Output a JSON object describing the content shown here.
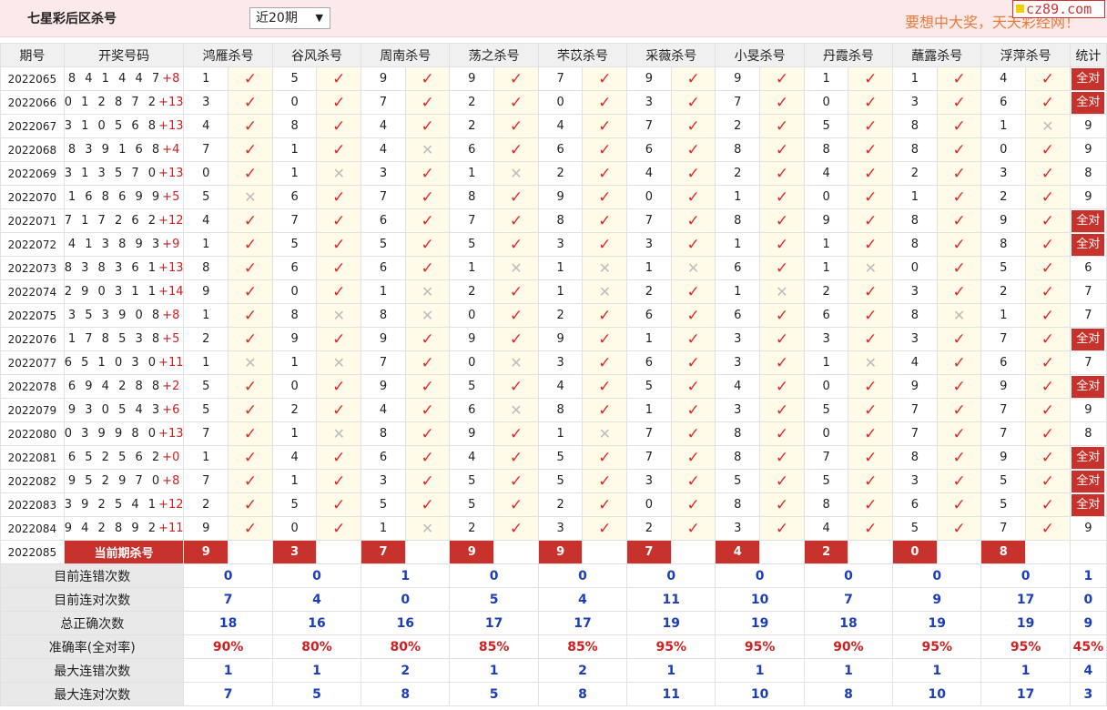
{
  "header": {
    "title": "七星彩后区杀号",
    "range_select": "近20期",
    "slogan": "要想中大奖，天天彩经网！",
    "logo_text": "cz89.com"
  },
  "columns": {
    "period": "期号",
    "draw": "开奖号码",
    "experts": [
      "鸿雁杀号",
      "谷风杀号",
      "周南杀号",
      "荡之杀号",
      "芣苡杀号",
      "采薇杀号",
      "小旻杀号",
      "丹霞杀号",
      "蘸露杀号",
      "浮萍杀号"
    ],
    "stat": "统计"
  },
  "rows": [
    {
      "period": "2022065",
      "nums": "8 4 1 4 4 7",
      "bonus": "+8",
      "picks": [
        "1",
        "5",
        "9",
        "9",
        "7",
        "9",
        "9",
        "1",
        "1",
        "4"
      ],
      "marks": [
        1,
        1,
        1,
        1,
        1,
        1,
        1,
        1,
        1,
        1
      ],
      "stat": "全对"
    },
    {
      "period": "2022066",
      "nums": "0 1 2 8 7 2",
      "bonus": "+13",
      "picks": [
        "3",
        "0",
        "7",
        "2",
        "0",
        "3",
        "7",
        "0",
        "3",
        "6"
      ],
      "marks": [
        1,
        1,
        1,
        1,
        1,
        1,
        1,
        1,
        1,
        1
      ],
      "stat": "全对"
    },
    {
      "period": "2022067",
      "nums": "3 1 0 5 6 8",
      "bonus": "+13",
      "picks": [
        "4",
        "8",
        "4",
        "2",
        "4",
        "7",
        "2",
        "5",
        "8",
        "1"
      ],
      "marks": [
        1,
        1,
        1,
        1,
        1,
        1,
        1,
        1,
        1,
        0
      ],
      "stat": "9"
    },
    {
      "period": "2022068",
      "nums": "8 3 9 1 6 8",
      "bonus": "+4",
      "picks": [
        "7",
        "1",
        "4",
        "6",
        "6",
        "6",
        "8",
        "8",
        "8",
        "0"
      ],
      "marks": [
        1,
        1,
        0,
        1,
        1,
        1,
        1,
        1,
        1,
        1
      ],
      "stat": "9"
    },
    {
      "period": "2022069",
      "nums": "3 1 3 5 7 0",
      "bonus": "+13",
      "picks": [
        "0",
        "1",
        "3",
        "1",
        "2",
        "4",
        "2",
        "4",
        "2",
        "3"
      ],
      "marks": [
        1,
        0,
        1,
        0,
        1,
        1,
        1,
        1,
        1,
        1
      ],
      "stat": "8"
    },
    {
      "period": "2022070",
      "nums": "1 6 8 6 9 9",
      "bonus": "+5",
      "picks": [
        "5",
        "6",
        "7",
        "8",
        "9",
        "0",
        "1",
        "0",
        "1",
        "2"
      ],
      "marks": [
        0,
        1,
        1,
        1,
        1,
        1,
        1,
        1,
        1,
        1
      ],
      "stat": "9"
    },
    {
      "period": "2022071",
      "nums": "7 1 7 2 6 2",
      "bonus": "+12",
      "picks": [
        "4",
        "7",
        "6",
        "7",
        "8",
        "7",
        "8",
        "9",
        "8",
        "9"
      ],
      "marks": [
        1,
        1,
        1,
        1,
        1,
        1,
        1,
        1,
        1,
        1
      ],
      "stat": "全对"
    },
    {
      "period": "2022072",
      "nums": "4 1 3 8 9 3",
      "bonus": "+9",
      "picks": [
        "1",
        "5",
        "5",
        "5",
        "3",
        "3",
        "1",
        "1",
        "8",
        "8"
      ],
      "marks": [
        1,
        1,
        1,
        1,
        1,
        1,
        1,
        1,
        1,
        1
      ],
      "stat": "全对"
    },
    {
      "period": "2022073",
      "nums": "8 3 8 3 6 1",
      "bonus": "+13",
      "picks": [
        "8",
        "6",
        "6",
        "1",
        "1",
        "1",
        "6",
        "1",
        "0",
        "5"
      ],
      "marks": [
        1,
        1,
        1,
        0,
        0,
        0,
        1,
        0,
        1,
        1
      ],
      "stat": "6"
    },
    {
      "period": "2022074",
      "nums": "2 9 0 3 1 1",
      "bonus": "+14",
      "picks": [
        "9",
        "0",
        "1",
        "2",
        "1",
        "2",
        "1",
        "2",
        "3",
        "2"
      ],
      "marks": [
        1,
        1,
        0,
        1,
        0,
        1,
        0,
        1,
        1,
        1
      ],
      "stat": "7"
    },
    {
      "period": "2022075",
      "nums": "3 5 3 9 0 8",
      "bonus": "+8",
      "picks": [
        "1",
        "8",
        "8",
        "0",
        "2",
        "6",
        "6",
        "6",
        "8",
        "1"
      ],
      "marks": [
        1,
        0,
        0,
        1,
        1,
        1,
        1,
        1,
        0,
        1
      ],
      "stat": "7"
    },
    {
      "period": "2022076",
      "nums": "1 7 8 5 3 8",
      "bonus": "+5",
      "picks": [
        "2",
        "9",
        "9",
        "9",
        "9",
        "1",
        "3",
        "3",
        "3",
        "7"
      ],
      "marks": [
        1,
        1,
        1,
        1,
        1,
        1,
        1,
        1,
        1,
        1
      ],
      "stat": "全对"
    },
    {
      "period": "2022077",
      "nums": "6 5 1 0 3 0",
      "bonus": "+11",
      "picks": [
        "1",
        "1",
        "7",
        "0",
        "3",
        "6",
        "3",
        "1",
        "4",
        "6"
      ],
      "marks": [
        0,
        0,
        1,
        0,
        1,
        1,
        1,
        0,
        1,
        1
      ],
      "stat": "7"
    },
    {
      "period": "2022078",
      "nums": "6 9 4 2 8 8",
      "bonus": "+2",
      "picks": [
        "5",
        "0",
        "9",
        "5",
        "4",
        "5",
        "4",
        "0",
        "9",
        "9"
      ],
      "marks": [
        1,
        1,
        1,
        1,
        1,
        1,
        1,
        1,
        1,
        1
      ],
      "stat": "全对"
    },
    {
      "period": "2022079",
      "nums": "9 3 0 5 4 3",
      "bonus": "+6",
      "picks": [
        "5",
        "2",
        "4",
        "6",
        "8",
        "1",
        "3",
        "5",
        "7",
        "7"
      ],
      "marks": [
        1,
        1,
        1,
        0,
        1,
        1,
        1,
        1,
        1,
        1
      ],
      "stat": "9"
    },
    {
      "period": "2022080",
      "nums": "0 3 9 9 8 0",
      "bonus": "+13",
      "picks": [
        "7",
        "1",
        "8",
        "9",
        "1",
        "7",
        "8",
        "0",
        "7",
        "7"
      ],
      "marks": [
        1,
        0,
        1,
        1,
        0,
        1,
        1,
        1,
        1,
        1
      ],
      "stat": "8"
    },
    {
      "period": "2022081",
      "nums": "6 5 2 5 6 2",
      "bonus": "+0",
      "picks": [
        "1",
        "4",
        "6",
        "4",
        "5",
        "7",
        "8",
        "7",
        "8",
        "9"
      ],
      "marks": [
        1,
        1,
        1,
        1,
        1,
        1,
        1,
        1,
        1,
        1
      ],
      "stat": "全对"
    },
    {
      "period": "2022082",
      "nums": "9 5 2 9 7 0",
      "bonus": "+8",
      "picks": [
        "7",
        "1",
        "3",
        "5",
        "5",
        "3",
        "5",
        "5",
        "3",
        "5"
      ],
      "marks": [
        1,
        1,
        1,
        1,
        1,
        1,
        1,
        1,
        1,
        1
      ],
      "stat": "全对"
    },
    {
      "period": "2022083",
      "nums": "3 9 2 5 4 1",
      "bonus": "+12",
      "picks": [
        "2",
        "5",
        "5",
        "5",
        "2",
        "0",
        "8",
        "8",
        "6",
        "5"
      ],
      "marks": [
        1,
        1,
        1,
        1,
        1,
        1,
        1,
        1,
        1,
        1
      ],
      "stat": "全对"
    },
    {
      "period": "2022084",
      "nums": "9 4 2 8 9 2",
      "bonus": "+11",
      "picks": [
        "9",
        "0",
        "1",
        "2",
        "3",
        "2",
        "3",
        "4",
        "5",
        "7"
      ],
      "marks": [
        1,
        1,
        0,
        1,
        1,
        1,
        1,
        1,
        1,
        1
      ],
      "stat": "9"
    }
  ],
  "current": {
    "period": "2022085",
    "label": "当前期杀号",
    "kills": [
      "9",
      "3",
      "7",
      "9",
      "9",
      "7",
      "4",
      "2",
      "0",
      "8"
    ]
  },
  "summary": [
    {
      "label": "目前连错次数",
      "values": [
        "0",
        "0",
        "1",
        "0",
        "0",
        "0",
        "0",
        "0",
        "0",
        "0",
        "1"
      ],
      "kind": "num"
    },
    {
      "label": "目前连对次数",
      "values": [
        "7",
        "4",
        "0",
        "5",
        "4",
        "11",
        "10",
        "7",
        "9",
        "17",
        "0"
      ],
      "kind": "num"
    },
    {
      "label": "总正确次数",
      "values": [
        "18",
        "16",
        "16",
        "17",
        "17",
        "19",
        "19",
        "18",
        "19",
        "19",
        "9"
      ],
      "kind": "num"
    },
    {
      "label": "准确率(全对率)",
      "values": [
        "90%",
        "80%",
        "80%",
        "85%",
        "85%",
        "95%",
        "95%",
        "90%",
        "95%",
        "95%",
        "45%"
      ],
      "kind": "rate"
    },
    {
      "label": "最大连错次数",
      "values": [
        "1",
        "1",
        "2",
        "1",
        "2",
        "1",
        "1",
        "1",
        "1",
        "1",
        "4"
      ],
      "kind": "num"
    },
    {
      "label": "最大连对次数",
      "values": [
        "7",
        "5",
        "8",
        "5",
        "8",
        "11",
        "10",
        "8",
        "10",
        "17",
        "3"
      ],
      "kind": "num"
    }
  ],
  "symbols": {
    "check": "✓",
    "cross": "✕"
  },
  "colors": {
    "accent_red": "#c8322c",
    "check_red": "#df2a2a",
    "summary_blue": "#1b3fb8",
    "header_bg": "#fce9e9",
    "mark_cell_bg": "#fffbe8"
  }
}
